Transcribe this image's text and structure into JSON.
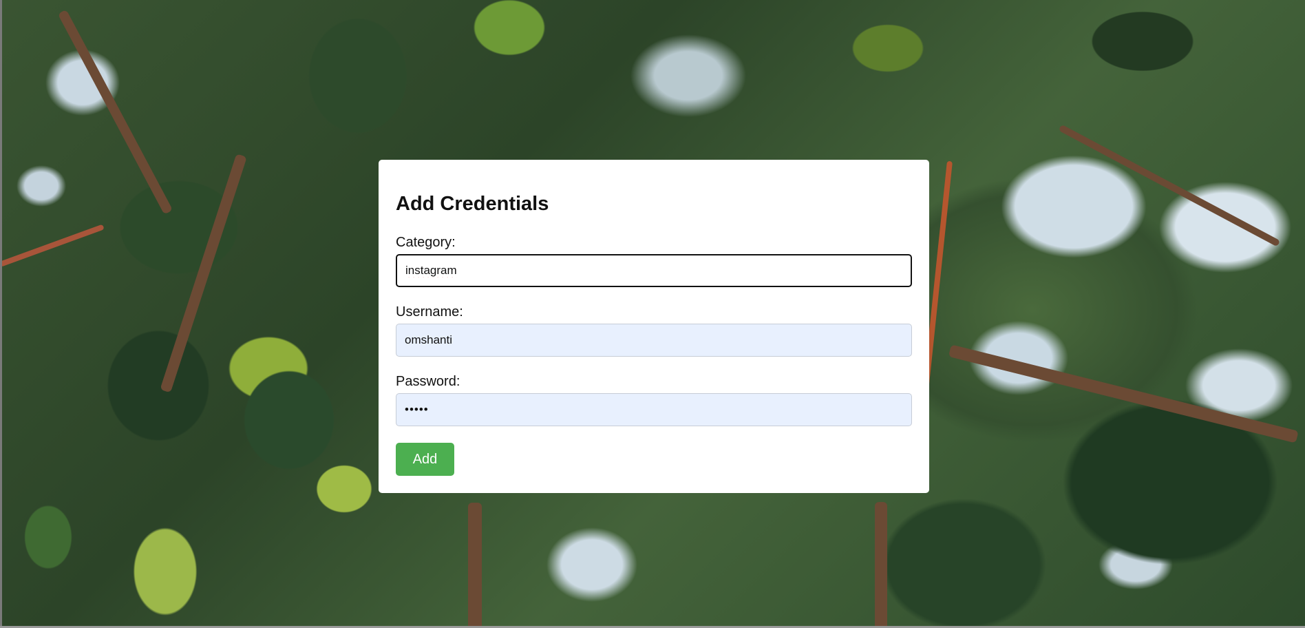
{
  "form": {
    "title": "Add Credentials",
    "category": {
      "label": "Category:",
      "value": "instagram"
    },
    "username": {
      "label": "Username:",
      "value": "omshanti"
    },
    "password": {
      "label": "Password:",
      "value": "•••••"
    },
    "submit_label": "Add"
  },
  "colors": {
    "submit_button": "#4caf50",
    "autofill_background": "#e8f0fe",
    "card_background": "#ffffff"
  }
}
